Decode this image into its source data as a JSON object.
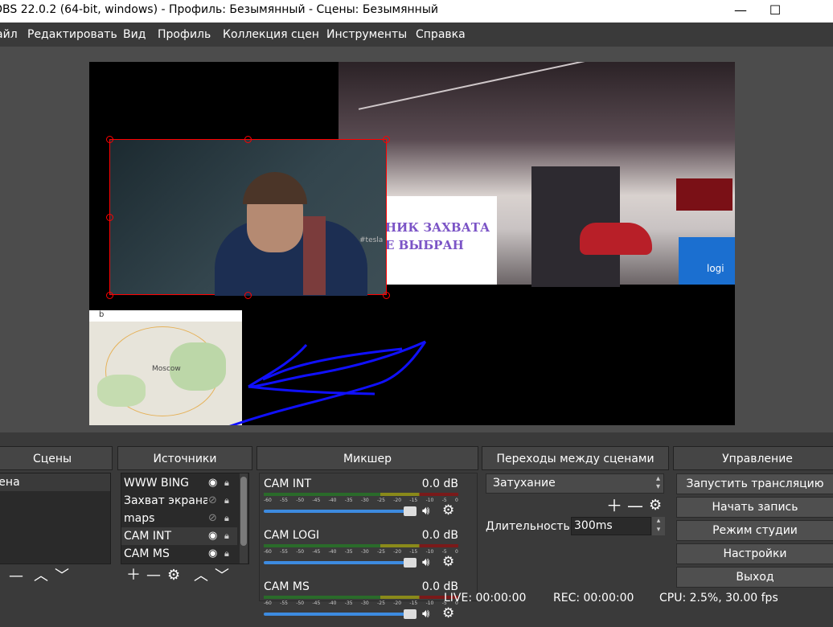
{
  "window": {
    "title": "OBS 22.0.2 (64-bit, windows) - Профиль: Безымянный - Сцены: Безымянный",
    "minimize": "—",
    "maximize": "☐"
  },
  "menu": [
    "Файл",
    "Редактировать",
    "Вид",
    "Профиль",
    "Коллекция сцен",
    "Инструменты",
    "Справка"
  ],
  "preview": {
    "capture_text_1": "НИК ЗАХВАТА",
    "capture_text_2": "Е ВЫБРАН",
    "webcam_label": "#tesla",
    "logi_label": "logi",
    "map_label": "Moscow",
    "map_logo": "b"
  },
  "scenes": {
    "header": "Сцены",
    "items": [
      "Сцена"
    ]
  },
  "sources": {
    "header": "Источники",
    "items": [
      {
        "name": "WWW BING",
        "visible": true
      },
      {
        "name": "Захват экрана",
        "visible": false
      },
      {
        "name": "maps",
        "visible": false
      },
      {
        "name": "CAM INT",
        "visible": true
      },
      {
        "name": "CAM MS",
        "visible": true
      }
    ]
  },
  "mixer": {
    "header": "Микшер",
    "tracks": [
      {
        "name": "CAM INT",
        "db": "0.0 dB"
      },
      {
        "name": "CAM LOGI",
        "db": "0.0 dB"
      },
      {
        "name": "CAM MS",
        "db": "0.0 dB"
      }
    ],
    "ticks": [
      "-60",
      "-55",
      "-50",
      "-45",
      "-40",
      "-35",
      "-30",
      "-25",
      "-20",
      "-15",
      "-10",
      "-5",
      "0"
    ]
  },
  "transitions": {
    "header": "Переходы между сценами",
    "selected": "Затухание",
    "duration_label": "Длительность",
    "duration_value": "300ms"
  },
  "controls": {
    "header": "Управление",
    "buttons": [
      "Запустить трансляцию",
      "Начать запись",
      "Режим студии",
      "Настройки",
      "Выход"
    ]
  },
  "status": {
    "live": "LIVE: 00:00:00",
    "rec": "REC: 00:00:00",
    "cpu": "CPU: 2.5%, 30.00 fps"
  },
  "colors": {
    "accent": "#3d8be0",
    "selection": "#ff0000",
    "drawing": "#1010ff"
  }
}
